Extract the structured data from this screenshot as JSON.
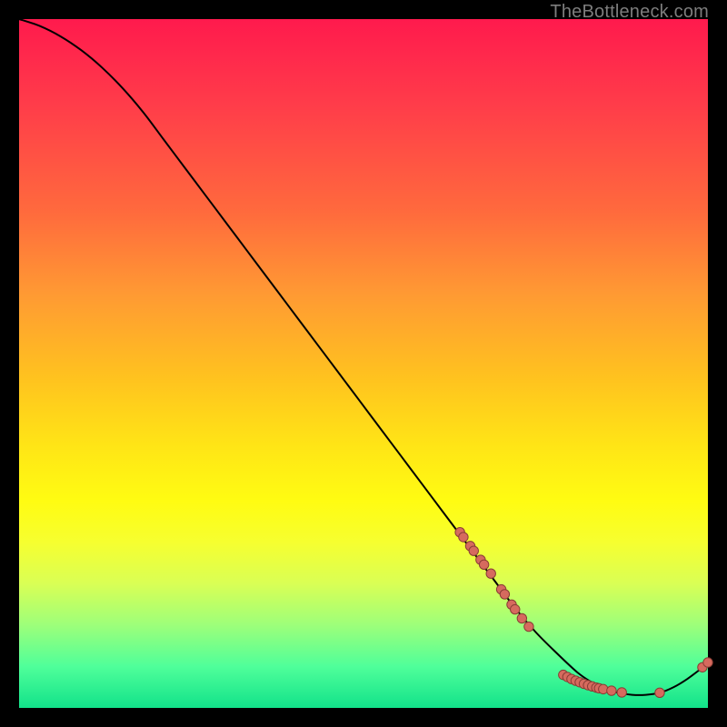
{
  "watermark": "TheBottleneck.com",
  "colors": {
    "dot_fill": "#d66a5e",
    "dot_stroke": "#893d35",
    "curve": "#000000"
  },
  "chart_data": {
    "type": "line",
    "title": "",
    "xlabel": "",
    "ylabel": "",
    "xlim": [
      0,
      100
    ],
    "ylim": [
      0,
      100
    ],
    "series": [
      {
        "name": "curve",
        "x": [
          0,
          3,
          6,
          9,
          12,
          15,
          18,
          21,
          24,
          27,
          30,
          33,
          36,
          39,
          42,
          45,
          48,
          51,
          54,
          57,
          60,
          63,
          66,
          69,
          72,
          75,
          78,
          81,
          83,
          85,
          87,
          89,
          91,
          93,
          95,
          97,
          99,
          100
        ],
        "y": [
          100,
          99,
          97.5,
          95.5,
          93,
          90,
          86.5,
          82.5,
          78.5,
          74.5,
          70.5,
          66.5,
          62.5,
          58.5,
          54.5,
          50.5,
          46.5,
          42.5,
          38.5,
          34.5,
          30.5,
          26.5,
          22.5,
          18.5,
          14.5,
          11,
          8,
          5.2,
          3.8,
          2.8,
          2.2,
          1.9,
          1.9,
          2.2,
          3.0,
          4.2,
          5.7,
          6.5
        ]
      }
    ],
    "markers": [
      {
        "x": 64.0,
        "y": 25.5
      },
      {
        "x": 64.5,
        "y": 24.8
      },
      {
        "x": 65.5,
        "y": 23.5
      },
      {
        "x": 66.0,
        "y": 22.8
      },
      {
        "x": 67.0,
        "y": 21.5
      },
      {
        "x": 67.5,
        "y": 20.8
      },
      {
        "x": 68.5,
        "y": 19.5
      },
      {
        "x": 70.0,
        "y": 17.2
      },
      {
        "x": 70.5,
        "y": 16.5
      },
      {
        "x": 71.5,
        "y": 15.0
      },
      {
        "x": 72.0,
        "y": 14.3
      },
      {
        "x": 73.0,
        "y": 13.0
      },
      {
        "x": 74.0,
        "y": 11.8
      },
      {
        "x": 79.0,
        "y": 4.8
      },
      {
        "x": 79.6,
        "y": 4.5
      },
      {
        "x": 80.2,
        "y": 4.2
      },
      {
        "x": 80.8,
        "y": 3.95
      },
      {
        "x": 81.4,
        "y": 3.72
      },
      {
        "x": 82.0,
        "y": 3.5
      },
      {
        "x": 82.6,
        "y": 3.3
      },
      {
        "x": 83.2,
        "y": 3.12
      },
      {
        "x": 83.8,
        "y": 2.95
      },
      {
        "x": 84.2,
        "y": 2.85
      },
      {
        "x": 84.8,
        "y": 2.72
      },
      {
        "x": 86.0,
        "y": 2.5
      },
      {
        "x": 87.5,
        "y": 2.25
      },
      {
        "x": 93.0,
        "y": 2.2
      },
      {
        "x": 99.2,
        "y": 5.9
      },
      {
        "x": 100.0,
        "y": 6.6
      }
    ]
  }
}
